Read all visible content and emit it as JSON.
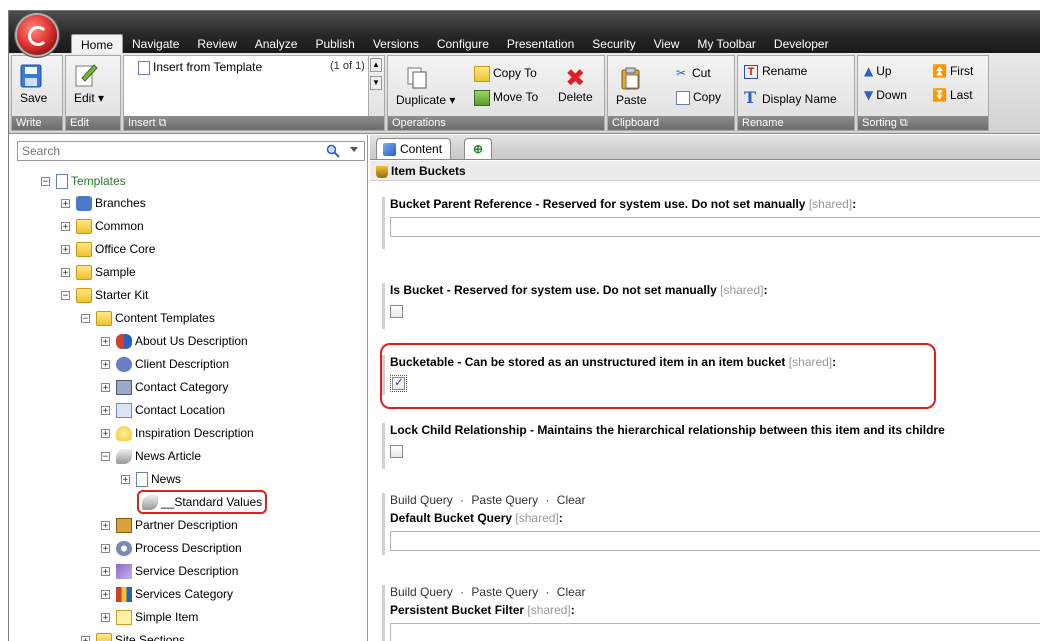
{
  "menu": {
    "tabs": [
      "Home",
      "Navigate",
      "Review",
      "Analyze",
      "Publish",
      "Versions",
      "Configure",
      "Presentation",
      "Security",
      "View",
      "My Toolbar",
      "Developer"
    ],
    "active_tab": "Home"
  },
  "ribbon": {
    "write": {
      "save": "Save",
      "label": "Write"
    },
    "edit": {
      "edit": "Edit",
      "label": "Edit"
    },
    "insert": {
      "insert_from_template": "Insert from Template",
      "count": "(1 of 1)",
      "label": "Insert"
    },
    "operations": {
      "duplicate": "Duplicate",
      "copy_to": "Copy To",
      "move_to": "Move To",
      "delete": "Delete",
      "label": "Operations"
    },
    "clipboard": {
      "paste": "Paste",
      "cut": "Cut",
      "copy": "Copy",
      "label": "Clipboard"
    },
    "rename": {
      "rename": "Rename",
      "display_name": "Display Name",
      "label": "Rename"
    },
    "sorting": {
      "up": "Up",
      "down": "Down",
      "first": "First",
      "last": "Last",
      "label": "Sorting"
    }
  },
  "search": {
    "placeholder": "Search"
  },
  "tree": {
    "templates": "Templates",
    "branches": "Branches",
    "common": "Common",
    "office_core": "Office Core",
    "sample": "Sample",
    "starter_kit": "Starter Kit",
    "content_templates": "Content Templates",
    "about_us": "About Us Description",
    "client_desc": "Client Description",
    "contact_category": "Contact Category",
    "contact_location": "Contact Location",
    "inspiration": "Inspiration Description",
    "news_article": "News Article",
    "news": "News",
    "standard_values": "__Standard Values",
    "partner": "Partner Description",
    "process": "Process Description",
    "service": "Service Description",
    "services_category": "Services Category",
    "simple_item": "Simple Item",
    "site_sections": "Site Sections"
  },
  "content": {
    "tab_label": "Content",
    "section_title": "Item Buckets",
    "shared_tag": "[shared]",
    "f1_label": "Bucket Parent Reference - Reserved for system use. Do not set manually",
    "f2_label": "Is Bucket - Reserved for system use. Do not set manually",
    "f3_label": "Bucketable - Can be stored as an unstructured item in an item bucket",
    "f4_label": "Lock Child Relationship - Maintains the hierarchical relationship between this item and its childre",
    "f5_label": "Default Bucket Query",
    "f6_label": "Persistent Bucket Filter",
    "build_query": "Build Query",
    "paste_query": "Paste Query",
    "clear": "Clear",
    "sep": "·",
    "colon": ":"
  }
}
